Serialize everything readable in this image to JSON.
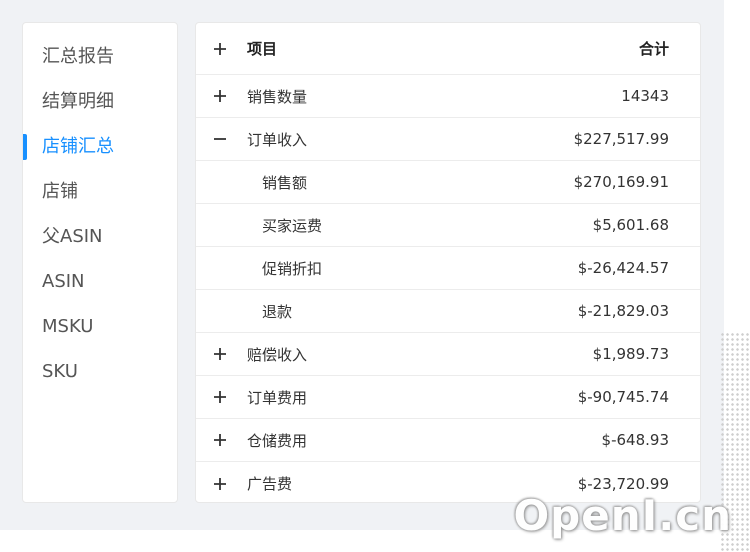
{
  "sidebar": {
    "items": [
      {
        "label": "汇总报告",
        "active": false
      },
      {
        "label": "结算明细",
        "active": false
      },
      {
        "label": "店铺汇总",
        "active": true
      },
      {
        "label": "店铺",
        "active": false
      },
      {
        "label": "父ASIN",
        "active": false
      },
      {
        "label": "ASIN",
        "active": false
      },
      {
        "label": "MSKU",
        "active": false
      },
      {
        "label": "SKU",
        "active": false
      }
    ],
    "accent_color": "#1890ff"
  },
  "table": {
    "header": {
      "toggle": "plus-icon",
      "name": "项目",
      "total": "合计"
    },
    "rows": [
      {
        "toggle": "plus-icon",
        "name": "销售数量",
        "total": "14343"
      },
      {
        "toggle": "minus-icon",
        "name": "订单收入",
        "total": "$227,517.99"
      },
      {
        "toggle": "",
        "name": "销售额",
        "total": "$270,169.91"
      },
      {
        "toggle": "",
        "name": "买家运费",
        "total": "$5,601.68"
      },
      {
        "toggle": "",
        "name": "促销折扣",
        "total": "$-26,424.57"
      },
      {
        "toggle": "",
        "name": "退款",
        "total": "$-21,829.03"
      },
      {
        "toggle": "plus-icon",
        "name": "赔偿收入",
        "total": "$1,989.73"
      },
      {
        "toggle": "plus-icon",
        "name": "订单费用",
        "total": "$-90,745.74"
      },
      {
        "toggle": "plus-icon",
        "name": "仓储费用",
        "total": "$-648.93"
      },
      {
        "toggle": "plus-icon",
        "name": "广告费",
        "total": "$-23,720.99"
      }
    ]
  },
  "watermark": "OpenI.cn"
}
